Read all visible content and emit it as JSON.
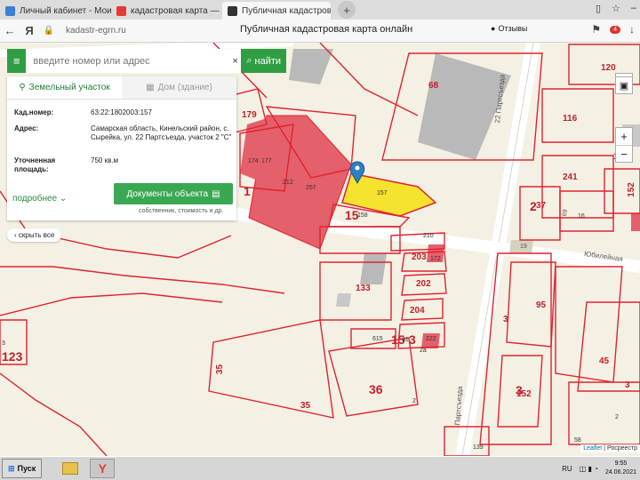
{
  "browser": {
    "tabs": [
      {
        "label": "Личный кабинет - Мои об",
        "active": false,
        "favicon_color": "#3b7fd6"
      },
      {
        "label": "кадастровая карта — Янд",
        "active": false,
        "favicon_color": "#e53935"
      },
      {
        "label": "Публичная кадастровая",
        "active": true,
        "favicon_color": "#333333"
      }
    ],
    "new_tab": "+",
    "url": "kadastr-egrn.ru",
    "page_title": "Публичная кадастровая карта онлайн",
    "reviews": "Отзывы",
    "yandex_badge": "4"
  },
  "search": {
    "placeholder": "введите номер или адрес",
    "clear": "×",
    "button": "найти"
  },
  "info_panel": {
    "tab_land": "Земельный участок",
    "tab_house": "Дом (здание)",
    "rows": [
      {
        "key": "Кад.номер:",
        "value": "63:22:1802003:157"
      },
      {
        "key": "Адрес:",
        "value": "Самарская область, Кинельский район, с. Сырейка, ул. 22 Партсъезда, участок 2 \"С\""
      },
      {
        "key": "Уточненная площадь:",
        "value": "750 кв.м"
      }
    ],
    "more": "подробнее",
    "docs_button": "Документы объекта",
    "docs_sub": "собственник, стоимость и др.",
    "hide_all": "скрыть все"
  },
  "map": {
    "labels": [
      "179",
      "174",
      "177",
      "212",
      "257",
      "157",
      "15",
      "158",
      "1",
      "68",
      "22 Партсъезда",
      "116",
      "241",
      "2",
      "37",
      "69",
      "16",
      "210",
      "203",
      "172",
      "202",
      "204",
      "133",
      "615",
      "15",
      "31",
      "3",
      "222",
      "2а",
      "19",
      "Юбилейная",
      "3",
      "95",
      "3",
      "152",
      "45",
      "35",
      "36",
      "2",
      "123",
      "35",
      "3",
      "120",
      "152",
      "157",
      "58",
      "139",
      "3",
      "2",
      "Партсъезда"
    ],
    "attribution_leaflet": "Leaflet",
    "attribution_rosreestr": "Росреестр"
  },
  "taskbar": {
    "start": "Пуск",
    "lang": "RU",
    "time": "9:55",
    "date": "24.06.2021"
  },
  "colors": {
    "accent_green": "#2f9e43",
    "parcel_red": "#e0232f",
    "building_fill": "#e85c62",
    "selected_parcel": "#f5e000"
  }
}
